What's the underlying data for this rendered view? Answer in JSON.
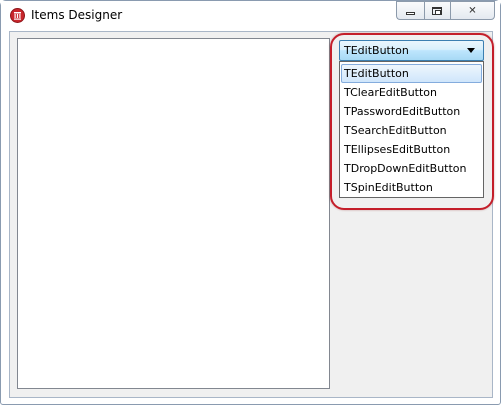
{
  "window": {
    "title": "Items Designer",
    "icon": "app-logo-icon",
    "caption_buttons": [
      "minimize-icon",
      "maximize-icon",
      "close-icon"
    ],
    "close_glyph": "✕"
  },
  "combo": {
    "selected": "TEditButton",
    "arrow_icon": "chevron-down-icon"
  },
  "dropdown": {
    "items": [
      "TEditButton",
      "TClearEditButton",
      "TPasswordEditButton",
      "TSearchEditButton",
      "TEllipsesEditButton",
      "TDropDownEditButton",
      "TSpinEditButton"
    ],
    "selected_index": 0
  },
  "colors": {
    "highlight_ring": "#c41e2a",
    "selection_border": "#84acdd",
    "combo_border": "#3c7fb1"
  }
}
